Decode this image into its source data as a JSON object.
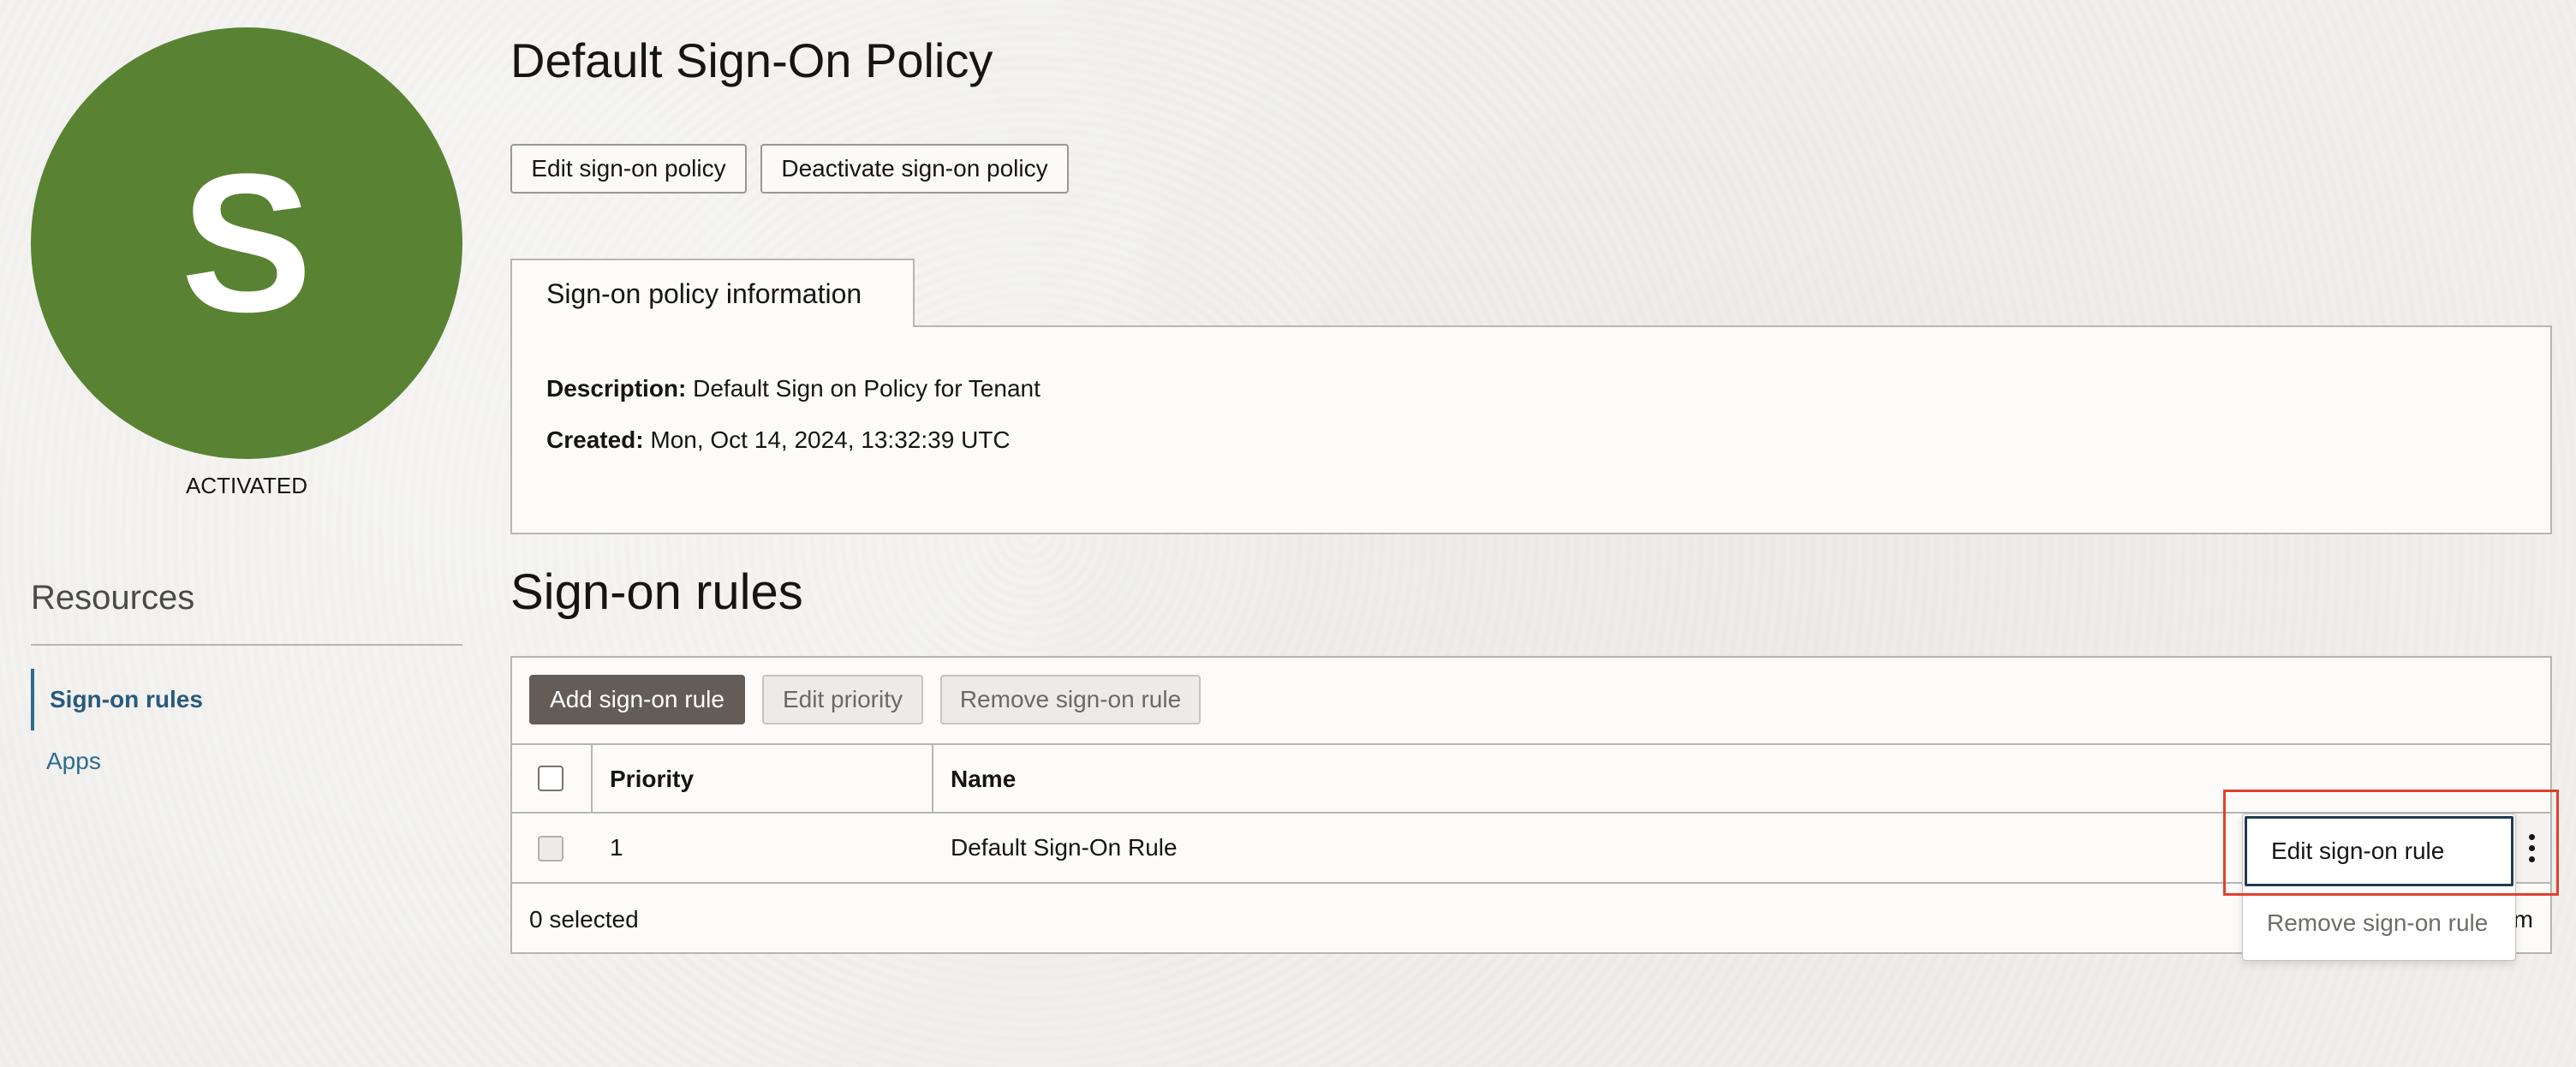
{
  "colors": {
    "avatar_bg": "#5a8233",
    "link": "#2d6b8f",
    "primary_button": "#645d57",
    "highlight": "#e0412d"
  },
  "avatar": {
    "letter": "S",
    "status": "ACTIVATED"
  },
  "resources": {
    "title": "Resources",
    "items": [
      {
        "label": "Sign-on rules",
        "active": true
      },
      {
        "label": "Apps",
        "active": false
      }
    ]
  },
  "page": {
    "title": "Default Sign-On Policy"
  },
  "actions": {
    "edit_policy": "Edit sign-on policy",
    "deactivate_policy": "Deactivate sign-on policy"
  },
  "info": {
    "tab_label": "Sign-on policy information",
    "description_label": "Description:",
    "description_value": "Default Sign on Policy for Tenant",
    "created_label": "Created:",
    "created_value": "Mon, Oct 14, 2024, 13:32:39 UTC"
  },
  "rules": {
    "title": "Sign-on rules",
    "toolbar": {
      "add": "Add sign-on rule",
      "edit_priority": "Edit priority",
      "remove": "Remove sign-on rule"
    },
    "columns": [
      "Priority",
      "Name"
    ],
    "rows": [
      {
        "priority": "1",
        "name": "Default Sign-On Rule"
      }
    ],
    "selected_text": "0 selected",
    "footer_tail": "m"
  },
  "row_menu": {
    "icon": "kebab-menu-icon",
    "items": [
      "Edit sign-on rule",
      "Remove sign-on rule"
    ]
  }
}
